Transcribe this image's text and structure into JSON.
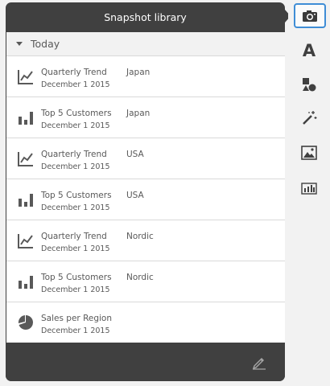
{
  "panel": {
    "title": "Snapshot library",
    "group": {
      "label": "Today"
    },
    "items": [
      {
        "title": "Quarterly Trend",
        "date": "December 1 2015",
        "filter": "Japan",
        "icon": "line-chart-icon"
      },
      {
        "title": "Top 5 Customers",
        "date": "December 1 2015",
        "filter": "Japan",
        "icon": "bar-chart-icon"
      },
      {
        "title": "Quarterly Trend",
        "date": "December 1 2015",
        "filter": "USA",
        "icon": "line-chart-icon"
      },
      {
        "title": "Top 5 Customers",
        "date": "December 1 2015",
        "filter": "USA",
        "icon": "bar-chart-icon"
      },
      {
        "title": "Quarterly Trend",
        "date": "December 1 2015",
        "filter": "Nordic",
        "icon": "line-chart-icon"
      },
      {
        "title": "Top 5 Customers",
        "date": "December 1 2015",
        "filter": "Nordic",
        "icon": "bar-chart-icon"
      },
      {
        "title": "Sales per Region",
        "date": "December 1 2015",
        "filter": "",
        "icon": "pie-chart-icon"
      }
    ],
    "footer": {
      "icon": "pencil-icon"
    }
  },
  "toolbar": {
    "items": [
      {
        "icon": "camera-icon",
        "active": true
      },
      {
        "icon": "text-icon"
      },
      {
        "icon": "shapes-icon"
      },
      {
        "icon": "magic-wand-icon"
      },
      {
        "icon": "image-icon"
      },
      {
        "icon": "chart-object-icon"
      }
    ],
    "text_glyph": "A"
  },
  "colors": {
    "panel_bg": "#404040",
    "accent": "#3f8dd6",
    "text": "#595959",
    "divider": "#d9d9d9"
  }
}
